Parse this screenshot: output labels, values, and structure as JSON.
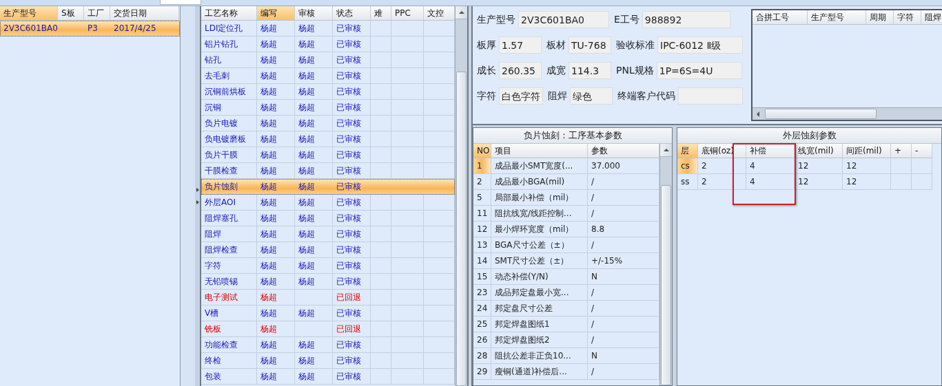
{
  "order_list": {
    "columns": [
      {
        "label": "生产型号",
        "sorted": true
      },
      {
        "label": "S板",
        "sorted": false
      },
      {
        "label": "工厂",
        "sorted": false
      },
      {
        "label": "交货日期",
        "sorted": false
      }
    ],
    "rows": [
      {
        "cells": [
          "2V3C601BA0",
          null,
          "P3",
          "2017/4/25"
        ],
        "selected": true
      }
    ]
  },
  "process_list": {
    "columns": [
      {
        "label": "工艺名称",
        "sorted": false
      },
      {
        "label": "编写",
        "sorted": true
      },
      {
        "label": "审核",
        "sorted": false
      },
      {
        "label": "状态",
        "sorted": false
      },
      {
        "label": "难",
        "sorted": false
      },
      {
        "label": "PPC",
        "sorted": false
      },
      {
        "label": "文控",
        "sorted": false
      }
    ],
    "rows": [
      {
        "cells": [
          "LDI定位孔",
          "杨超",
          "杨超",
          "已审核"
        ],
        "selected": false,
        "returned": false
      },
      {
        "cells": [
          "铝片钻孔",
          "杨超",
          "杨超",
          "已审核"
        ],
        "selected": false,
        "returned": false
      },
      {
        "cells": [
          "钻孔",
          "杨超",
          "杨超",
          "已审核"
        ],
        "selected": false,
        "returned": false
      },
      {
        "cells": [
          "去毛刺",
          "杨超",
          "杨超",
          "已审核"
        ],
        "selected": false,
        "returned": false
      },
      {
        "cells": [
          "沉铜前烘板",
          "杨超",
          "杨超",
          "已审核"
        ],
        "selected": false,
        "returned": false
      },
      {
        "cells": [
          "沉铜",
          "杨超",
          "杨超",
          "已审核"
        ],
        "selected": false,
        "returned": false
      },
      {
        "cells": [
          "负片电镀",
          "杨超",
          "杨超",
          "已审核"
        ],
        "selected": false,
        "returned": false
      },
      {
        "cells": [
          "负电镀磨板",
          "杨超",
          "杨超",
          "已审核"
        ],
        "selected": false,
        "returned": false
      },
      {
        "cells": [
          "负片干膜",
          "杨超",
          "杨超",
          "已审核"
        ],
        "selected": false,
        "returned": false
      },
      {
        "cells": [
          "干膜检查",
          "杨超",
          "杨超",
          "已审核"
        ],
        "selected": false,
        "returned": false
      },
      {
        "cells": [
          "负片蚀刻",
          "杨超",
          "杨超",
          "已审核"
        ],
        "selected": true,
        "returned": false
      },
      {
        "cells": [
          "外层AOI",
          "杨超",
          "杨超",
          "已审核"
        ],
        "selected": false,
        "returned": false
      },
      {
        "cells": [
          "阻焊塞孔",
          "杨超",
          "杨超",
          "已审核"
        ],
        "selected": false,
        "returned": false
      },
      {
        "cells": [
          "阻焊",
          "杨超",
          "杨超",
          "已审核"
        ],
        "selected": false,
        "returned": false
      },
      {
        "cells": [
          "阻焊检查",
          "杨超",
          "杨超",
          "已审核"
        ],
        "selected": false,
        "returned": false
      },
      {
        "cells": [
          "字符",
          "杨超",
          "杨超",
          "已审核"
        ],
        "selected": false,
        "returned": false
      },
      {
        "cells": [
          "无铅喷锡",
          "杨超",
          "杨超",
          "已审核"
        ],
        "selected": false,
        "returned": false
      },
      {
        "cells": [
          "电子测试",
          "杨超",
          null,
          "已回退"
        ],
        "selected": false,
        "returned": true
      },
      {
        "cells": [
          "V槽",
          "杨超",
          "杨超",
          "已审核"
        ],
        "selected": false,
        "returned": false
      },
      {
        "cells": [
          "铣板",
          "杨超",
          null,
          "已回退"
        ],
        "selected": false,
        "returned": true
      },
      {
        "cells": [
          "功能检查",
          "杨超",
          "杨超",
          "已审核"
        ],
        "selected": false,
        "returned": false
      },
      {
        "cells": [
          "终检",
          "杨超",
          "杨超",
          "已审核"
        ],
        "selected": false,
        "returned": false
      },
      {
        "cells": [
          "包装",
          "杨超",
          "杨超",
          "已审核"
        ],
        "selected": false,
        "returned": false
      }
    ]
  },
  "info_form": {
    "fields": [
      {
        "label": "生产型号",
        "value": "2V3C601BA0"
      },
      {
        "label": "E工号",
        "value": "988892"
      },
      {
        "label": "板厚",
        "value": "1.57"
      },
      {
        "label": "板材",
        "value": "TU-768"
      },
      {
        "label": "验收标准",
        "value": "IPC-6012 Ⅱ级"
      },
      {
        "label": "成长",
        "value": "260.35"
      },
      {
        "label": "成宽",
        "value": "114.3"
      },
      {
        "label": "PNL规格",
        "value": "1P=6S=4U"
      },
      {
        "label": "字符",
        "value": "白色字符"
      },
      {
        "label": "阻焊",
        "value": "绿色"
      },
      {
        "label": "终端客户代码"
      }
    ]
  },
  "merge_list": {
    "columns": [
      {
        "label": "合拼工号"
      },
      {
        "label": "生产型号"
      },
      {
        "label": "周期"
      },
      {
        "label": "字符"
      },
      {
        "label": "阻焊"
      }
    ]
  },
  "basic_params": {
    "title": "负片蚀刻：工序基本参数",
    "columns": [
      {
        "label": "NO",
        "sorted": true
      },
      {
        "label": "项目",
        "sorted": false
      },
      {
        "label": "参数",
        "sorted": false
      }
    ],
    "rows": [
      {
        "cells": [
          "1",
          "成品最小SMT宽度(...",
          "37.000"
        ],
        "current": true
      },
      {
        "cells": [
          "2",
          "成品最小BGA(mil)",
          "/"
        ],
        "current": false
      },
      {
        "cells": [
          "5",
          "局部最小补偿（mil）",
          "/"
        ],
        "current": false
      },
      {
        "cells": [
          "11",
          "阻抗线宽/线距控制...",
          "/"
        ],
        "current": false
      },
      {
        "cells": [
          "12",
          "最小焊环宽度（mil）",
          "8.8"
        ],
        "current": false
      },
      {
        "cells": [
          "13",
          "BGA尺寸公差（±）",
          "/"
        ],
        "current": false
      },
      {
        "cells": [
          "14",
          "SMT尺寸公差（±）",
          "+/-15%"
        ],
        "current": false
      },
      {
        "cells": [
          "15",
          "动态补偿(Y/N)",
          "N"
        ],
        "current": false
      },
      {
        "cells": [
          "23",
          "成品邦定盘最小宽...",
          "/"
        ],
        "current": false
      },
      {
        "cells": [
          "24",
          "邦定盘尺寸公差",
          "/"
        ],
        "current": false
      },
      {
        "cells": [
          "25",
          "邦定焊盘图纸1",
          "/"
        ],
        "current": false
      },
      {
        "cells": [
          "26",
          "邦定焊盘图纸2",
          "/"
        ],
        "current": false
      },
      {
        "cells": [
          "28",
          "阻抗公差非正负10...",
          "N"
        ],
        "current": false
      },
      {
        "cells": [
          "29",
          "瘦铜(通道)补偿后...",
          "/"
        ],
        "current": false
      }
    ]
  },
  "outer_params": {
    "title": "外层蚀刻参数",
    "columns": [
      {
        "label": "层",
        "sorted": true
      },
      {
        "label": "底铜(oz)",
        "sorted": false
      },
      {
        "label": "补偿",
        "sorted": false
      },
      {
        "label": "线宽(mil)",
        "sorted": false
      },
      {
        "label": "间距(mil)",
        "sorted": false
      },
      {
        "label": "+",
        "sorted": false
      },
      {
        "label": "-",
        "sorted": false
      }
    ],
    "rows": [
      {
        "cells": [
          "cs",
          "2",
          "4",
          "12",
          "12"
        ],
        "current": true
      },
      {
        "cells": [
          "ss",
          "2",
          "4",
          "12",
          "12"
        ],
        "current": false
      }
    ]
  }
}
